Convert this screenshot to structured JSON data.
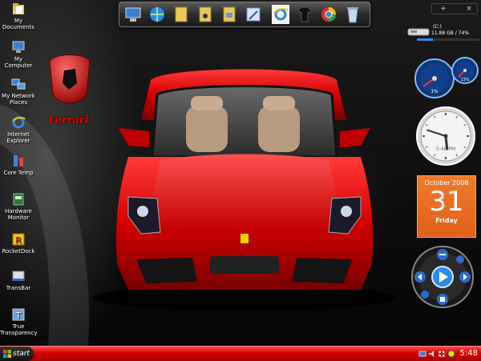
{
  "desktop_icons": [
    {
      "label": "My Documents",
      "icon": "folder-documents-icon"
    },
    {
      "label": "My Computer",
      "icon": "computer-icon"
    },
    {
      "label": "My Network Places",
      "icon": "network-icon"
    },
    {
      "label": "Internet Explorer",
      "icon": "internet-explorer-icon"
    },
    {
      "label": "Core Temp",
      "icon": "core-temp-icon"
    },
    {
      "label": "Hardware Monitor",
      "icon": "hardware-monitor-icon"
    },
    {
      "label": "RocketDock",
      "icon": "rocketdock-icon"
    },
    {
      "label": "TransBar",
      "icon": "transbar-icon"
    },
    {
      "label": "True Transparency",
      "icon": "true-transparency-icon"
    }
  ],
  "wallpaper": {
    "brand": "Ferrari",
    "car_color": "#d40000"
  },
  "dock": {
    "items": [
      {
        "icon": "computer-icon"
      },
      {
        "icon": "network-icon"
      },
      {
        "icon": "folder-icon"
      },
      {
        "icon": "music-folder-icon"
      },
      {
        "icon": "pictures-folder-icon"
      },
      {
        "icon": "edit-document-icon"
      },
      {
        "icon": "internet-explorer-icon"
      },
      {
        "icon": "tshirt-icon"
      },
      {
        "icon": "browser-icon"
      },
      {
        "icon": "recycle-bin-icon"
      }
    ]
  },
  "sidebar": {
    "add_label": "+",
    "close_label": "×"
  },
  "drive_gadget": {
    "label": "(C:)",
    "info": "11.88 GB / 74%",
    "usage_fraction": 0.26
  },
  "cpu_gadget": {
    "value_a": "1%",
    "value_b": "13%"
  },
  "clock_gadget": {
    "time": "5:48 PM",
    "hour": 5,
    "minute": 48
  },
  "calendar_gadget": {
    "month": "October 2008",
    "day": "31",
    "weekday": "Friday"
  },
  "taskbar": {
    "start_label": "start",
    "clock": "5:48",
    "accent": "#d40000"
  }
}
